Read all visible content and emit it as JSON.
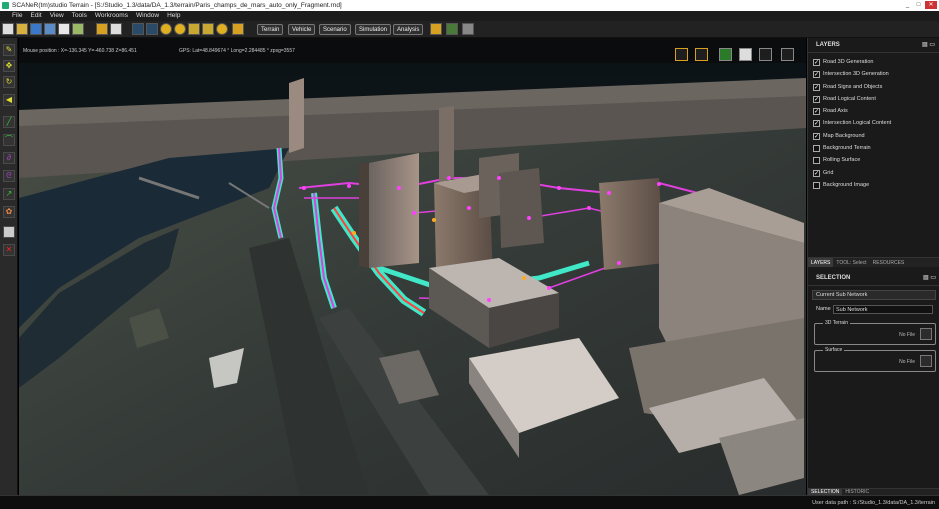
{
  "window": {
    "title": "SCANeR(tm)studio Terrain - [S:/Studio_1.3/data/DA_1.3/terrain/Paris_champs_de_mars_auto_only_Fragment.rnd]",
    "controls": {
      "minimize": "_",
      "maximize": "□",
      "close": "✕"
    }
  },
  "menu": [
    "File",
    "Edit",
    "View",
    "Tools",
    "Workrooms",
    "Window",
    "Help"
  ],
  "toolbar": {
    "workrooms": [
      "Terrain",
      "Vehicle",
      "Scenario",
      "Simulation",
      "Analysis"
    ],
    "active_workroom": "Terrain"
  },
  "viewport": {
    "mouse_position": "Mouse position : X=-136.345   Y=-460.738   Z=86.451",
    "gps": "GPS:  Lat=48.849674 °   Long=2.284485 °   zpsg=3557"
  },
  "layers_panel": {
    "title": "LAYERS",
    "items": [
      {
        "label": "Road 3D Generation",
        "checked": true
      },
      {
        "label": "Intersection 3D Generation",
        "checked": true
      },
      {
        "label": "Road Signs and Objects",
        "checked": true
      },
      {
        "label": "Road Logical Content",
        "checked": true
      },
      {
        "label": "Road Axis",
        "checked": true
      },
      {
        "label": "Intersection Logical Content",
        "checked": true
      },
      {
        "label": "Map Background",
        "checked": true
      },
      {
        "label": "Background Terrain",
        "checked": false
      },
      {
        "label": "Rolling Surface",
        "checked": false
      },
      {
        "label": "Grid",
        "checked": true
      },
      {
        "label": "Background Image",
        "checked": false
      }
    ]
  },
  "mid_tabs": [
    "LAYERS",
    "TOOL: Select",
    "RESOURCES"
  ],
  "selection_panel": {
    "title": "SELECTION",
    "current": "Current Sub Network",
    "name_label": "Name",
    "name_value": "Sub Network",
    "groups": [
      {
        "label": "3D Terrain",
        "value": "No File"
      },
      {
        "label": "Surface",
        "value": "No File"
      }
    ]
  },
  "bottom_tabs": [
    "SELECTION",
    "HISTORIC"
  ],
  "status": {
    "path": "User data path : S:/Studio_1.3/data/DA_1.3/terrain"
  },
  "colors": {
    "road_route": "#e040e0",
    "road_surface": "#40e8c8",
    "river": "#1a2a36"
  }
}
